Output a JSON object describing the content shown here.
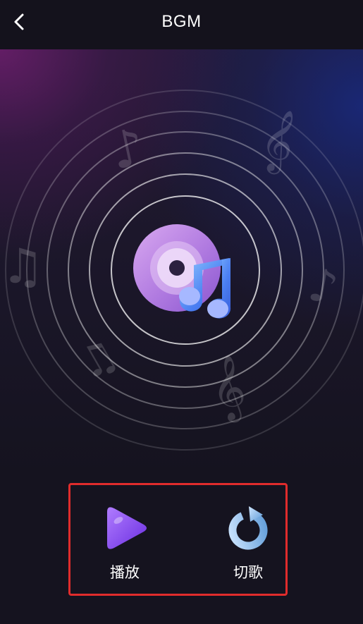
{
  "header": {
    "title": "BGM",
    "back_icon": "chevron-left-icon"
  },
  "hero": {
    "center_icon": "music-disc-icon",
    "decoration_icons": [
      "music-note-icon",
      "treble-clef-icon",
      "beamed-notes-icon"
    ],
    "colors": {
      "top_left_glow": "#6e1e6e",
      "top_right_glow": "#192878",
      "ring": "#ffffff"
    }
  },
  "controls": {
    "play": {
      "label": "播放",
      "icon": "play-icon",
      "color": "#8a4df0"
    },
    "next": {
      "label": "切歌",
      "icon": "refresh-icon",
      "color": "#7ab6e6"
    },
    "highlight_border_color": "#e02c2c"
  },
  "notes": {
    "note_1": "♪",
    "clef_1": "𝄞",
    "beamed_1": "♫",
    "note_2": "♪",
    "beamed_2": "♫",
    "clef_2": "𝄞"
  }
}
